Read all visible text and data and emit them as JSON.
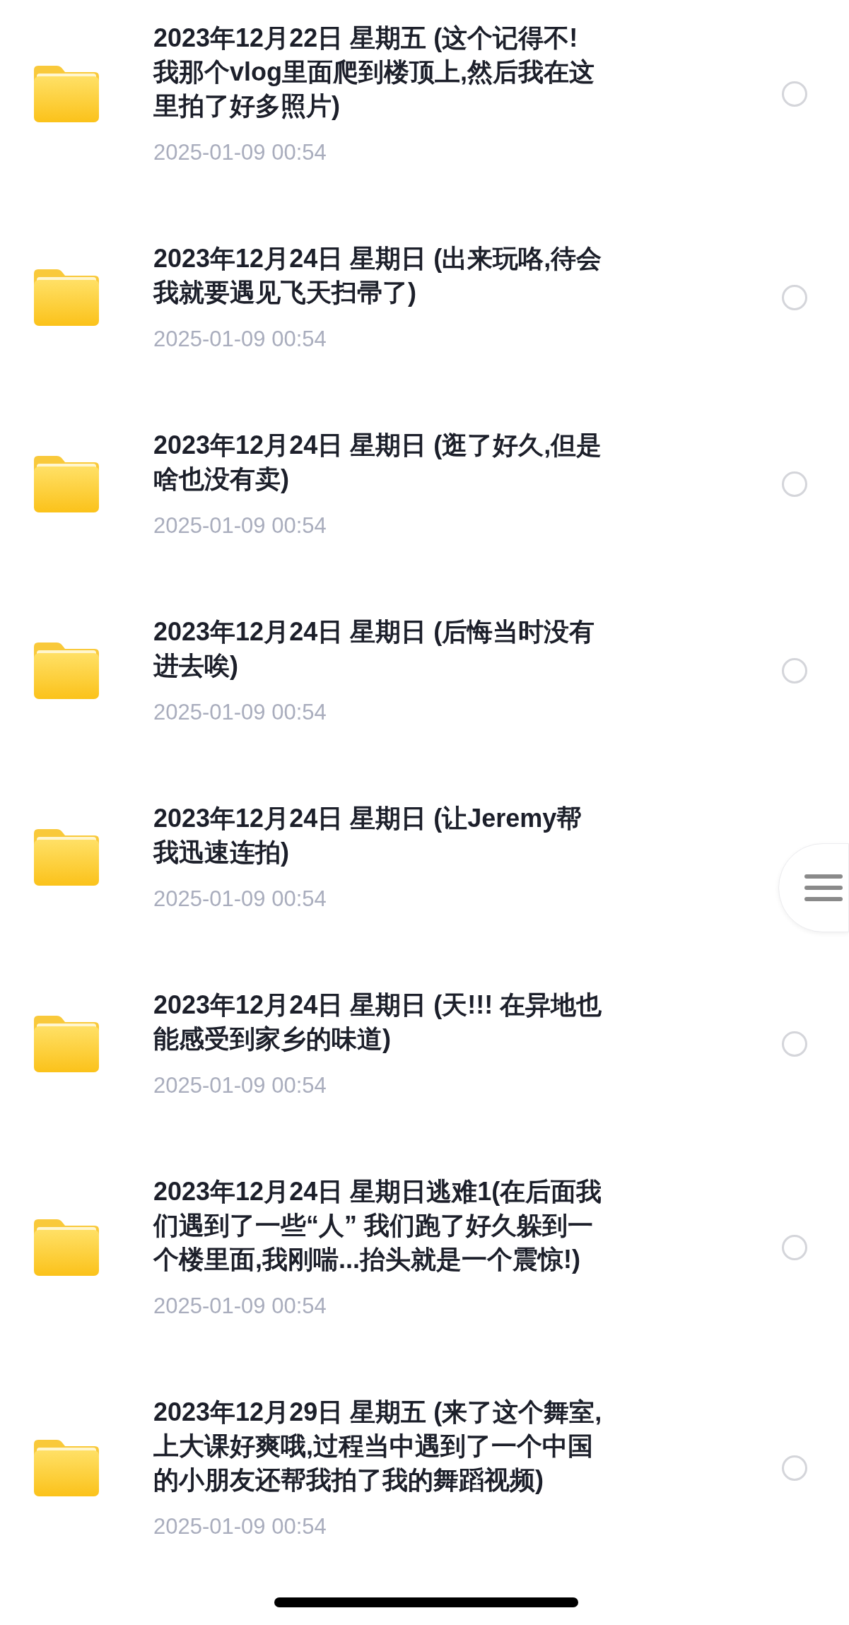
{
  "folders": [
    {
      "title": "2023年12月22日 星期五 (这个记得不! 我那个vlog里面爬到楼顶上,然后我在这里拍了好多照片)",
      "date": "2025-01-09 00:54",
      "selected": false
    },
    {
      "title": "2023年12月24日 星期日 (出来玩咯,待会我就要遇见飞天扫帚了)",
      "date": "2025-01-09 00:54",
      "selected": false
    },
    {
      "title": "2023年12月24日 星期日 (逛了好久,但是啥也没有卖)",
      "date": "2025-01-09 00:54",
      "selected": false
    },
    {
      "title": "2023年12月24日 星期日 (后悔当时没有进去唉)",
      "date": "2025-01-09 00:54",
      "selected": false
    },
    {
      "title": "2023年12月24日 星期日 (让Jeremy帮我迅速连拍)",
      "date": "2025-01-09 00:54"
    },
    {
      "title": "2023年12月24日 星期日 (天!!! 在异地也能感受到家乡的味道)",
      "date": "2025-01-09 00:54",
      "selected": false
    },
    {
      "title": "2023年12月24日 星期日逃难1(在后面我们遇到了一些“人” 我们跑了好久躲到一个楼里面,我刚喘...抬头就是一个震惊!)",
      "date": "2025-01-09 00:54",
      "selected": false
    },
    {
      "title": "2023年12月29日 星期五 (来了这个舞室,上大课好爽哦,过程当中遇到了一个中国的小朋友还帮我拍了我的舞蹈视频)",
      "date": "2025-01-09 00:54",
      "selected": false
    }
  ]
}
